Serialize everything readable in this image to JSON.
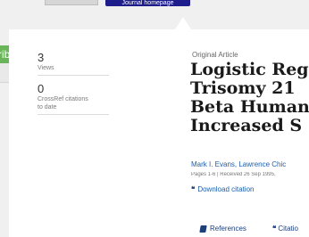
{
  "header": {
    "journal_button": "Journal homepage",
    "green_tab_label": "rib"
  },
  "metrics": [
    {
      "value": "3",
      "label": "Views"
    },
    {
      "value": "0",
      "label_line1": "CrossRef citations",
      "label_line2": "to date"
    }
  ],
  "article": {
    "type": "Original Article",
    "title_lines": [
      "Logistic Reg",
      "Trisomy 21",
      "Beta Human",
      "Increased S"
    ],
    "authors": "Mark I. Evans, Lawrence Chic",
    "pages_info": "Pages 1-6 | Received 26 Sep 1995,",
    "download": "Download citation"
  },
  "tabs": {
    "references": "References",
    "citations": "Citatio"
  }
}
